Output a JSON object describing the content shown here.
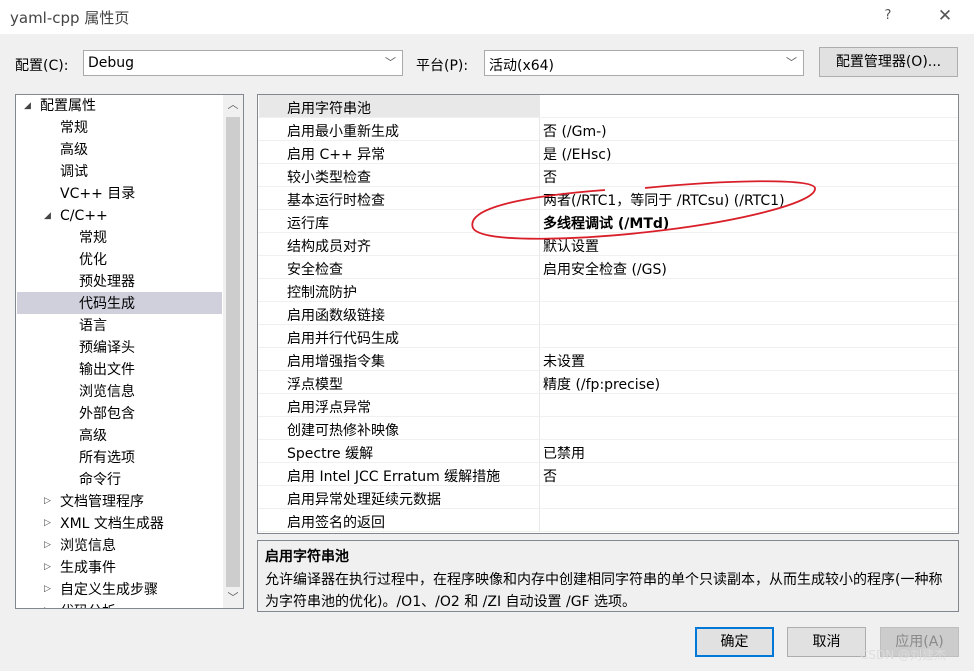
{
  "window": {
    "title": "yaml-cpp 属性页",
    "help": "?",
    "close": "✕"
  },
  "config": {
    "label": "配置(C):",
    "value": "Debug"
  },
  "platform": {
    "label": "平台(P):",
    "value": "活动(x64)"
  },
  "config_manager_label": "配置管理器(O)...",
  "tree": {
    "root": "配置属性",
    "level1": [
      {
        "label": "常规"
      },
      {
        "label": "高级"
      },
      {
        "label": "调试"
      },
      {
        "label": "VC++ 目录"
      },
      {
        "label": "C/C++"
      }
    ],
    "cpp_children": [
      "常规",
      "优化",
      "预处理器",
      "代码生成",
      "语言",
      "预编译头",
      "输出文件",
      "浏览信息",
      "外部包含",
      "高级",
      "所有选项",
      "命令行"
    ],
    "collapsed": [
      "文档管理程序",
      "XML 文档生成器",
      "浏览信息",
      "生成事件",
      "自定义生成步骤",
      "代码分析"
    ]
  },
  "properties": [
    {
      "name": "启用字符串池",
      "value": ""
    },
    {
      "name": "启用最小重新生成",
      "value": "否 (/Gm-)"
    },
    {
      "name": "启用 C++ 异常",
      "value": "是 (/EHsc)"
    },
    {
      "name": "较小类型检查",
      "value": "否"
    },
    {
      "name": "基本运行时检查",
      "value": "两者(/RTC1，等同于 /RTCsu) (/RTC1)"
    },
    {
      "name": "运行库",
      "value": "多线程调试 (/MTd)"
    },
    {
      "name": "结构成员对齐",
      "value": "默认设置"
    },
    {
      "name": "安全检查",
      "value": "启用安全检查 (/GS)"
    },
    {
      "name": "控制流防护",
      "value": ""
    },
    {
      "name": "启用函数级链接",
      "value": ""
    },
    {
      "name": "启用并行代码生成",
      "value": ""
    },
    {
      "name": "启用增强指令集",
      "value": "未设置"
    },
    {
      "name": "浮点模型",
      "value": "精度 (/fp:precise)"
    },
    {
      "name": "启用浮点异常",
      "value": ""
    },
    {
      "name": "创建可热修补映像",
      "value": ""
    },
    {
      "name": "Spectre 缓解",
      "value": "已禁用"
    },
    {
      "name": "启用 Intel JCC Erratum 缓解措施",
      "value": "否"
    },
    {
      "name": "启用异常处理延续元数据",
      "value": ""
    },
    {
      "name": "启用签名的返回",
      "value": ""
    }
  ],
  "description": {
    "title": "启用字符串池",
    "text": "允许编译器在执行过程中，在程序映像和内存中创建相同字符串的单个只读副本，从而生成较小的程序(一种称为字符串池的优化)。/O1、/O2 和 /ZI 自动设置 /GF 选项。"
  },
  "buttons": {
    "ok": "确定",
    "cancel": "取消",
    "apply": "应用(A)"
  },
  "watermark": "CSDN @刘建杰",
  "colors": {
    "selection": "#cfd0dc",
    "annotation": "#d9202a",
    "ok_border": "#0078d7"
  }
}
